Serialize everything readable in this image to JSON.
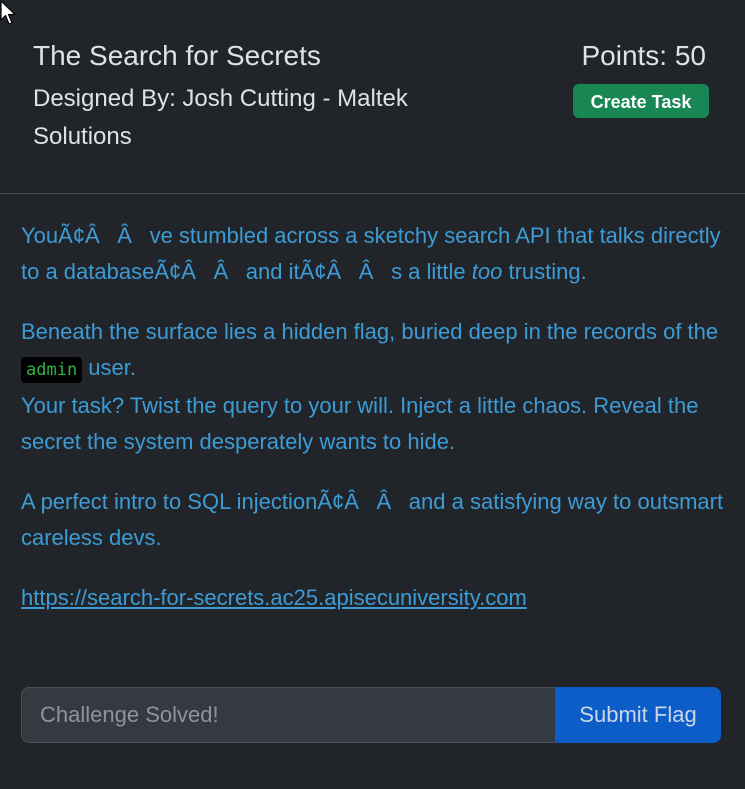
{
  "header": {
    "title": "The Search for Secrets",
    "designer": "Designed By: Josh Cutting - Maltek Solutions",
    "points": "Points: 50",
    "create_task_label": "Create Task"
  },
  "description": {
    "p1_a": "YouÃ¢ÂÂve stumbled across a sketchy search API that talks directly to a databaseÃ¢ÂÂand itÃ¢ÂÂs a little ",
    "p1_em": "too",
    "p1_b": " trusting.",
    "p2_a": "Beneath the surface lies a hidden flag, buried deep in the records of the ",
    "p2_code": "admin",
    "p2_b": " user.",
    "p2_c": "Your task? Twist the query to your will. Inject a little chaos. Reveal the secret the system desperately wants to hide.",
    "p3": "A perfect intro to SQL injectionÃ¢ÂÂand a satisfying way to outsmart careless devs.",
    "link": "https://search-for-secrets.ac25.apisecuniversity.com"
  },
  "form": {
    "flag_placeholder": "Challenge Solved!",
    "submit_label": "Submit Flag"
  },
  "colors": {
    "background": "#212529",
    "body_text": "#3d9bd6",
    "create_button": "#198754",
    "submit_button": "#0d5dc8"
  },
  "icons": {
    "cursor": "mouse-pointer-icon"
  }
}
